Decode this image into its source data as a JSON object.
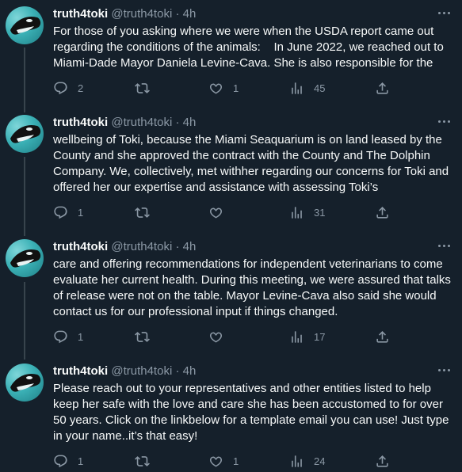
{
  "colors": {
    "background": "#15202b",
    "text": "#f7f9f9",
    "muted": "#8b98a5",
    "thread_line": "#38444d"
  },
  "icons": {
    "avatar": "orca-avatar",
    "more": "more-horizontal-icon",
    "reply": "reply-icon",
    "retweet": "retweet-icon",
    "like": "heart-icon",
    "views": "views-chart-icon",
    "share": "share-icon"
  },
  "tweets": [
    {
      "name": "truth4toki",
      "handle": "@truth4toki",
      "separator": "·",
      "time": "4h",
      "text": "For those of you asking where we were when the USDA report came out regarding the conditions of the animals:    In June 2022, we reached out to Miami-Dade Mayor Daniela Levine-Cava. She is also responsible for the",
      "replies": "2",
      "retweets": "",
      "likes": "1",
      "views": "45"
    },
    {
      "name": "truth4toki",
      "handle": "@truth4toki",
      "separator": "·",
      "time": "4h",
      "text": "wellbeing of Toki, because the Miami Seaquarium is on land leased by the County and she approved the contract with the County and The Dolphin Company. We, collectively, met withher regarding our concerns for Toki and offered her our expertise and assistance with assessing Toki’s",
      "replies": "1",
      "retweets": "",
      "likes": "",
      "views": "31"
    },
    {
      "name": "truth4toki",
      "handle": "@truth4toki",
      "separator": "·",
      "time": "4h",
      "text": "care and offering recommendations for independent veterinarians to come evaluate her current health. During this meeting, we were assured that talks of release were not on the table. Mayor Levine-Cava also said she would contact us for our professional input if things changed.",
      "replies": "1",
      "retweets": "",
      "likes": "",
      "views": "17"
    },
    {
      "name": "truth4toki",
      "handle": "@truth4toki",
      "separator": "·",
      "time": "4h",
      "text": "Please reach out to your representatives and other entities listed to help keep her safe with the love and care she has been accustomed to for over 50 years. Click on the linkbelow for a template email you can use! Just type in your name..it’s that easy!",
      "replies": "1",
      "retweets": "",
      "likes": "1",
      "views": "24"
    }
  ]
}
